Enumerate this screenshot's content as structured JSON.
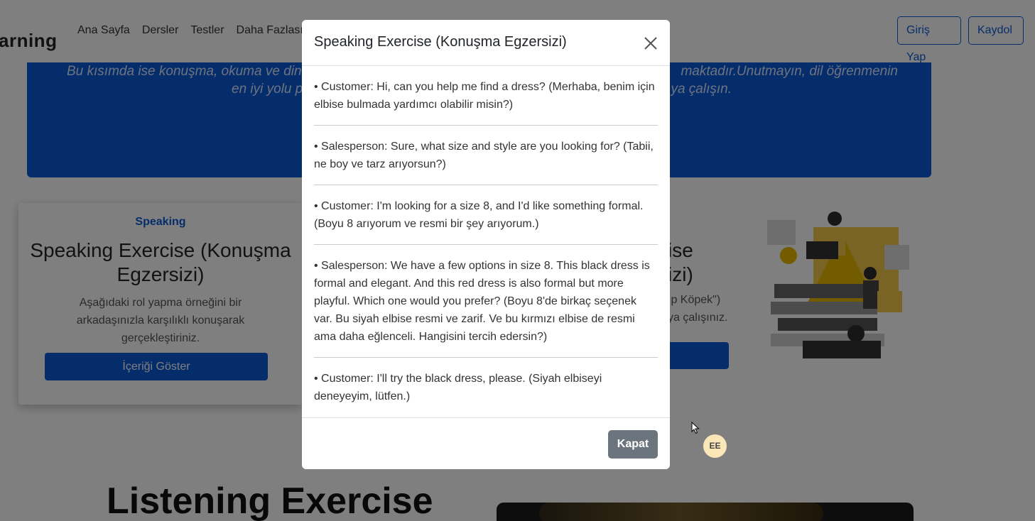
{
  "nav": {
    "brand": "arning",
    "links": [
      "Ana Sayfa",
      "Dersler",
      "Testler",
      "Daha Fazlası"
    ],
    "login": "Giriş Yap",
    "register": "Kaydol"
  },
  "hero": {
    "line1_left": "Bu kısımda ise konuşma, okuma ve din",
    "line1_right": "maktadır.Unutmayın, dil öğrenmenin",
    "line2_left": "en iyi yolu p",
    "line2_right": "ya çalışın."
  },
  "card_left": {
    "category": "Speaking",
    "title": "Speaking Exercise (Konuşma Egzersizi)",
    "description": "Aşağıdaki rol yapma örneğini bir arkadaşınızla karşılıklı konuşarak gerçekleştiriniz.",
    "button": "İçeriği Göster"
  },
  "card_right": {
    "title_line1": "ise",
    "title_line2": "izi)",
    "desc_line1": "ıp Köpek\")",
    "desc_line2": "ya çalışınız."
  },
  "listening": {
    "title": "Listening Exercise"
  },
  "avatar": {
    "initials": "EE"
  },
  "modal": {
    "title": "Speaking Exercise (Konuşma Egzersizi)",
    "lines": [
      "• Customer: Hi, can you help me find a dress? (Merhaba, benim için elbise bulmada yardımcı olabilir misin?)",
      "• Salesperson: Sure, what size and style are you looking for? (Tabii, ne boy ve tarz arıyorsun?)",
      "• Customer: I'm looking for a size 8, and I'd like something formal. (Boyu 8 arıyorum ve resmi bir şey arıyorum.)",
      "• Salesperson: We have a few options in size 8. This black dress is formal and elegant. And this red dress is also formal but more playful. Which one would you prefer? (Boyu 8'de birkaç seçenek var. Bu siyah elbise resmi ve zarif. Ve bu kırmızı elbise de resmi ama daha eğlenceli. Hangisini tercih edersin?)",
      "• Customer: I'll try the black dress, please. (Siyah elbiseyi deneyeyim, lütfen.)"
    ],
    "close_button": "Kapat",
    "close_icon": "close-icon"
  },
  "colors": {
    "primary": "#0d5bd7",
    "secondary_button": "#6c757d",
    "backdrop": "rgba(0,0,0,0.5)"
  }
}
